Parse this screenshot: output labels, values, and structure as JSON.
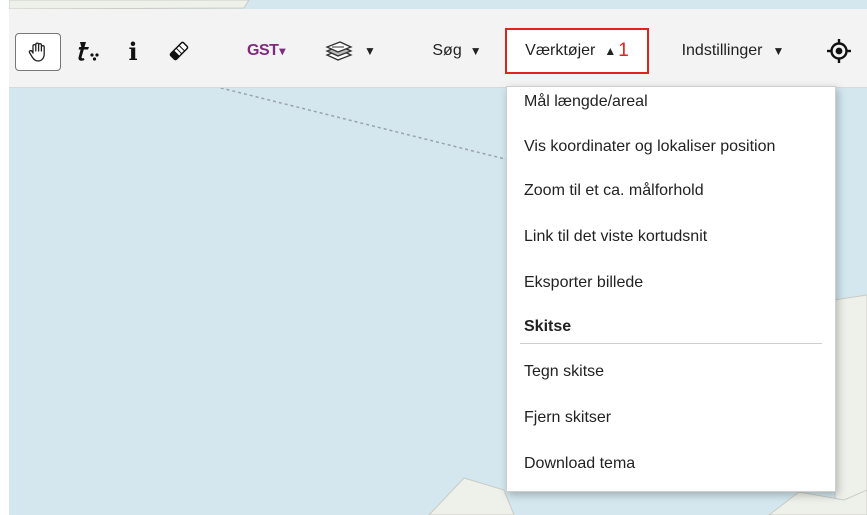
{
  "toolbar": {
    "info_glyph": "i",
    "gst_label": "GST",
    "gst_caret": "▾",
    "layers_caret": "▼",
    "search_label": "Søg",
    "search_caret": "▼",
    "tools_label": "Værktøjer",
    "tools_caret": "▲",
    "tools_marker": "1",
    "settings_label": "Indstillinger",
    "settings_caret": "▼"
  },
  "icons": {
    "pan": "hand-icon",
    "locate_text": "text-tool-icon",
    "info": "info-icon",
    "eraser": "eraser-icon",
    "layers": "layers-icon",
    "position": "target-icon"
  },
  "tools_menu": {
    "items": [
      "Mål længde/areal",
      "Vis koordinater og lokaliser position",
      "Zoom til et ca. målforhold",
      "Link til det viste kortudsnit",
      "Eksporter billede"
    ],
    "section_header": "Skitse",
    "sketch_items": [
      "Tegn skitse",
      "Fjern skitser",
      "Download tema"
    ]
  },
  "colors": {
    "highlight_border": "#e0231f",
    "gst_brand": "#7d2c7c",
    "map_water": "#d4e7ef"
  }
}
